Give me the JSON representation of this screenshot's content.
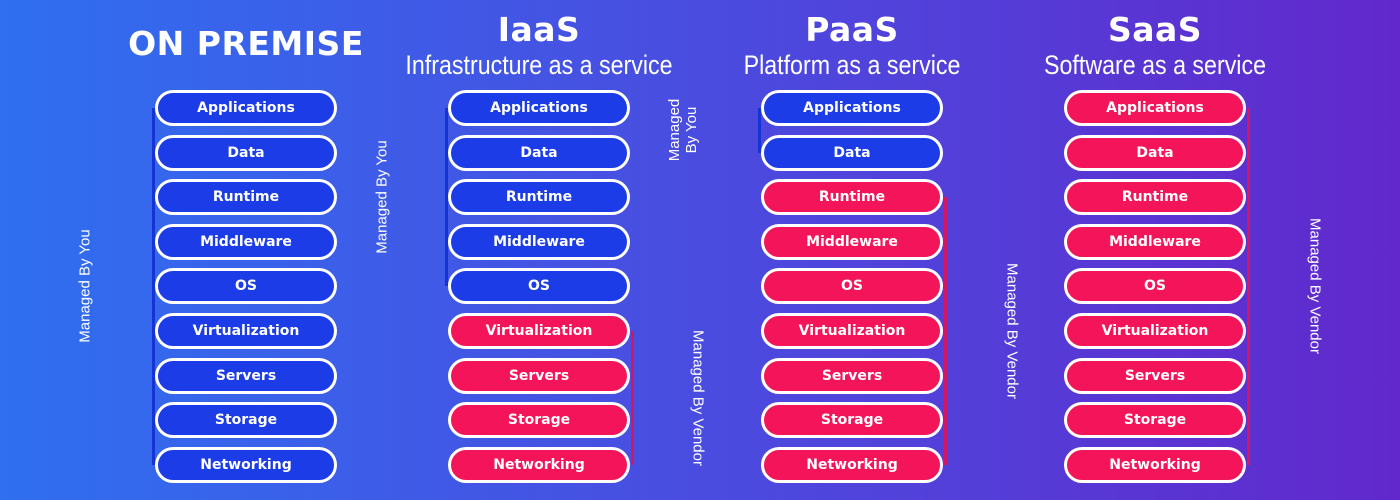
{
  "colors": {
    "managed_by_you": "#1b3ce6",
    "managed_by_vendor": "#f4145a",
    "background_start": "#2f6ff0",
    "background_end": "#6228cc"
  },
  "layers": [
    "Applications",
    "Data",
    "Runtime",
    "Middleware",
    "OS",
    "Virtualization",
    "Servers",
    "Storage",
    "Networking"
  ],
  "columns": [
    {
      "title": "ON PREMISE",
      "subtitle": "",
      "you_count": 9,
      "labels": {
        "you": "Managed By You",
        "vendor": ""
      }
    },
    {
      "title": "IaaS",
      "subtitle": "Infrastructure as a service",
      "you_count": 5,
      "labels": {
        "you": "Managed By You",
        "vendor": "Managed By Vendor"
      }
    },
    {
      "title": "PaaS",
      "subtitle": "Platform as a service",
      "you_count": 2,
      "labels": {
        "you": "Managed\nBy You",
        "vendor": "Managed By Vendor"
      }
    },
    {
      "title": "SaaS",
      "subtitle": "Software as a service",
      "you_count": 0,
      "labels": {
        "you": "",
        "vendor": "Managed By Vendor"
      }
    }
  ]
}
